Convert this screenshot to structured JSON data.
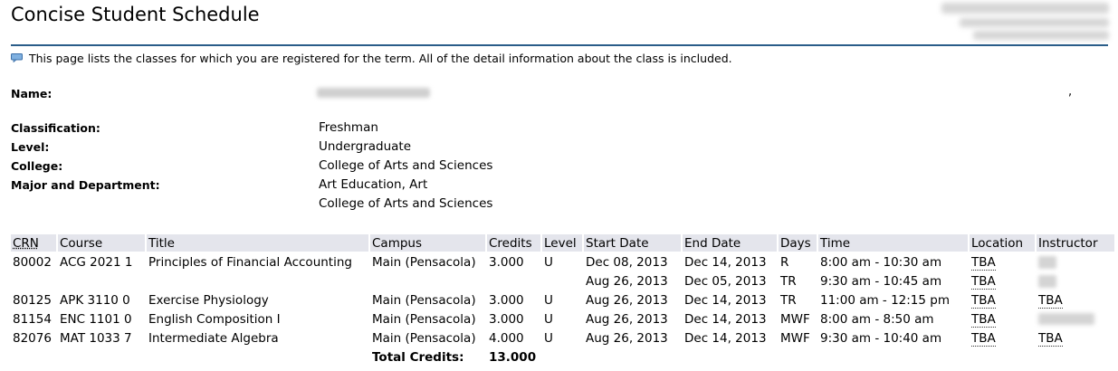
{
  "page": {
    "title": "Concise Student Schedule",
    "info_text": "This page lists the classes for which you are registered for the term. All of the detail information about the class is included."
  },
  "student": {
    "name_label": "Name:",
    "name_suffix": ",",
    "classification_label": "Classification:",
    "classification": "Freshman",
    "level_label": "Level:",
    "level": "Undergraduate",
    "college_label": "College:",
    "college": "College of Arts and Sciences",
    "major_label": "Major and Department:",
    "major": "Art Education, Art",
    "major_college": "College of Arts and Sciences"
  },
  "schedule": {
    "headers": {
      "crn": "CRN",
      "course": "Course",
      "title": "Title",
      "campus": "Campus",
      "credits": "Credits",
      "level": "Level",
      "start_date": "Start Date",
      "end_date": "End Date",
      "days": "Days",
      "time": "Time",
      "location": "Location",
      "instructor": "Instructor"
    },
    "rows": [
      {
        "crn": "80002",
        "course": "ACG 2021 1",
        "title": "Principles of Financial Accounting",
        "campus": "Main (Pensacola)",
        "credits": "3.000",
        "level": "U",
        "start": "Dec 08, 2013",
        "end": "Dec 14, 2013",
        "days": "R",
        "time": "8:00 am - 10:30 am",
        "location": "TBA",
        "instructor": ""
      },
      {
        "crn": "",
        "course": "",
        "title": "",
        "campus": "",
        "credits": "",
        "level": "",
        "start": "Aug 26, 2013",
        "end": "Dec 05, 2013",
        "days": "TR",
        "time": "9:30 am - 10:45 am",
        "location": "TBA",
        "instructor": ""
      },
      {
        "crn": "80125",
        "course": "APK 3110 0",
        "title": "Exercise Physiology",
        "campus": "Main (Pensacola)",
        "credits": "3.000",
        "level": "U",
        "start": "Aug 26, 2013",
        "end": "Dec 14, 2013",
        "days": "TR",
        "time": "11:00 am - 12:15 pm",
        "location": "TBA",
        "instructor": "TBA"
      },
      {
        "crn": "81154",
        "course": "ENC 1101 0",
        "title": "English Composition I",
        "campus": "Main (Pensacola)",
        "credits": "3.000",
        "level": "U",
        "start": "Aug 26, 2013",
        "end": "Dec 14, 2013",
        "days": "MWF",
        "time": "8:00 am - 8:50 am",
        "location": "TBA",
        "instructor": ""
      },
      {
        "crn": "82076",
        "course": "MAT 1033 7",
        "title": "Intermediate Algebra",
        "campus": "Main (Pensacola)",
        "credits": "4.000",
        "level": "U",
        "start": "Aug 26, 2013",
        "end": "Dec 14, 2013",
        "days": "MWF",
        "time": "9:30 am - 10:40 am",
        "location": "TBA",
        "instructor": "TBA"
      }
    ],
    "total_label": "Total Credits:",
    "total_credits": "13.000"
  },
  "colors": {
    "header_bg": "#e4e5ec",
    "rule": "#2a5d89"
  },
  "icons": {
    "info": "speech-bubble-icon"
  }
}
